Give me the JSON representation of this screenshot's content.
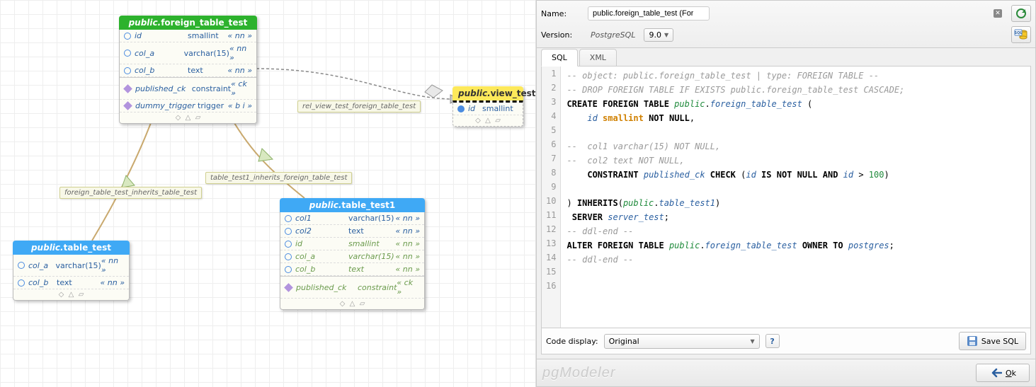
{
  "tables": {
    "ftt": {
      "schema": "public.",
      "name": "foreign_table_test",
      "cols": [
        {
          "name": "id",
          "type": "smallint",
          "flags": "« nn »",
          "icon": "circ"
        },
        {
          "name": "col_a",
          "type": "varchar(15)",
          "flags": "« nn »",
          "icon": "circ"
        },
        {
          "name": "col_b",
          "type": "text",
          "flags": "« nn »",
          "icon": "circ"
        }
      ],
      "extras": [
        {
          "name": "published_ck",
          "type": "constraint",
          "flags": "« ck »",
          "icon": "diamond"
        },
        {
          "name": "dummy_trigger",
          "type": "trigger",
          "flags": "« b i »",
          "icon": "diamond"
        }
      ]
    },
    "vt": {
      "schema": "public.",
      "name": "view_test",
      "cols": [
        {
          "name": "id",
          "type": "smallint",
          "flags": "",
          "icon": "circfill"
        }
      ]
    },
    "tt1": {
      "schema": "public.",
      "name": "table_test1",
      "cols": [
        {
          "name": "col1",
          "type": "varchar(15)",
          "flags": "« nn »",
          "icon": "circ"
        },
        {
          "name": "col2",
          "type": "text",
          "flags": "« nn »",
          "icon": "circ"
        },
        {
          "name": "id",
          "type": "smallint",
          "flags": "« nn »",
          "icon": "circ",
          "inh": true
        },
        {
          "name": "col_a",
          "type": "varchar(15)",
          "flags": "« nn »",
          "icon": "circ",
          "inh": true
        },
        {
          "name": "col_b",
          "type": "text",
          "flags": "« nn »",
          "icon": "circ",
          "inh": true
        }
      ],
      "extras": [
        {
          "name": "published_ck",
          "type": "constraint",
          "flags": "« ck »",
          "icon": "diamond",
          "inh": true
        }
      ]
    },
    "tt": {
      "schema": "public.",
      "name": "table_test",
      "cols": [
        {
          "name": "col_a",
          "type": "varchar(15)",
          "flags": "« nn »",
          "icon": "circ"
        },
        {
          "name": "col_b",
          "type": "text",
          "flags": "« nn »",
          "icon": "circ"
        }
      ]
    }
  },
  "rel_labels": {
    "r1": "rel_view_test_foreign_table_test",
    "r2": "table_test1_inherits_foreign_table_test",
    "r3": "foreign_table_test_inherits_table_test"
  },
  "form": {
    "name_label": "Name:",
    "name_value": "public.foreign_table_test (Foreign Table)",
    "version_label": "Version:",
    "version_engine": "PostgreSQL",
    "version_num": "9.0"
  },
  "tabs": {
    "sql": "SQL",
    "xml": "XML"
  },
  "sql_lines": [
    {
      "t": "comment",
      "txt": "-- object: public.foreign_table_test | type: FOREIGN TABLE --"
    },
    {
      "t": "comment",
      "txt": "-- DROP FOREIGN TABLE IF EXISTS public.foreign_table_test CASCADE;"
    },
    {
      "t": "l3"
    },
    {
      "t": "l4"
    },
    {
      "t": "blank"
    },
    {
      "t": "comment",
      "txt": "--  col1 varchar(15) NOT NULL,"
    },
    {
      "t": "comment",
      "txt": "--  col2 text NOT NULL,"
    },
    {
      "t": "l8"
    },
    {
      "t": "blank"
    },
    {
      "t": "l10"
    },
    {
      "t": "l11"
    },
    {
      "t": "comment",
      "txt": "-- ddl-end --"
    },
    {
      "t": "l13"
    },
    {
      "t": "comment",
      "txt": "-- ddl-end --"
    },
    {
      "t": "blank"
    },
    {
      "t": "blank"
    }
  ],
  "code_display_label": "Code display:",
  "code_display_value": "Original",
  "save_sql": "Save SQL",
  "logo": "pgModeler",
  "ok": "Ok"
}
